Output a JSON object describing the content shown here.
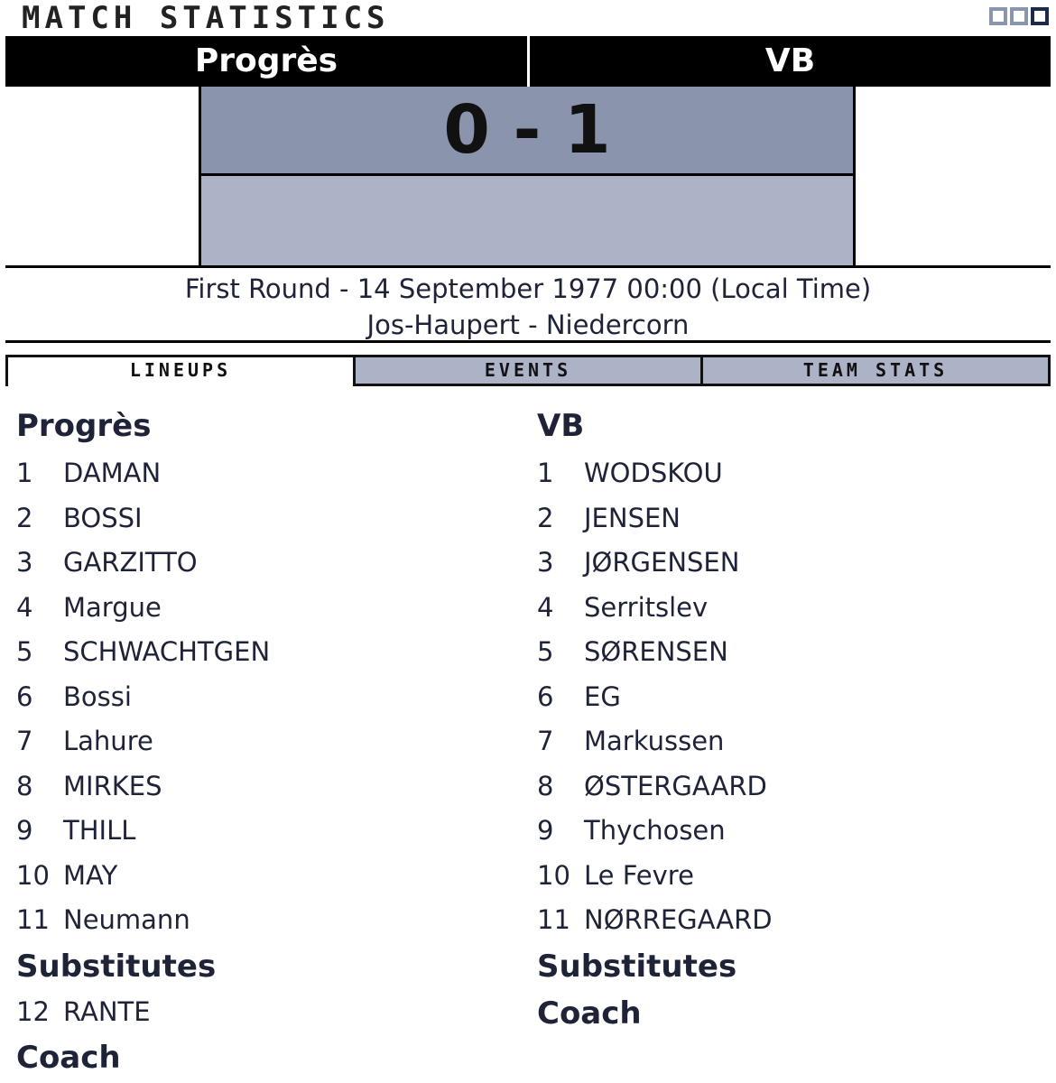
{
  "header": {
    "title": "Match Statistics"
  },
  "match": {
    "home_team": "Progrès",
    "away_team": "VB",
    "score": "0 - 1",
    "round_line": "First Round - 14 September 1977 00:00 (Local Time)",
    "venue_line": "Jos-Haupert - Niedercorn"
  },
  "tabs": [
    {
      "label": "Lineups",
      "active": true
    },
    {
      "label": "Events",
      "active": false
    },
    {
      "label": "Team Stats",
      "active": false
    }
  ],
  "lineups": {
    "home": {
      "team": "Progrès",
      "players": [
        {
          "num": "1",
          "name": "DAMAN"
        },
        {
          "num": "2",
          "name": "BOSSI"
        },
        {
          "num": "3",
          "name": "GARZITTO"
        },
        {
          "num": "4",
          "name": "Margue"
        },
        {
          "num": "5",
          "name": "SCHWACHTGEN"
        },
        {
          "num": "6",
          "name": "Bossi"
        },
        {
          "num": "7",
          "name": "Lahure"
        },
        {
          "num": "8",
          "name": "MIRKES"
        },
        {
          "num": "9",
          "name": "THILL"
        },
        {
          "num": "10",
          "name": "MAY"
        },
        {
          "num": "11",
          "name": "Neumann"
        }
      ],
      "substitutes_label": "Substitutes",
      "substitutes": [
        {
          "num": "12",
          "name": "RANTE"
        }
      ],
      "coach_label": "Coach"
    },
    "away": {
      "team": "VB",
      "players": [
        {
          "num": "1",
          "name": "WODSKOU"
        },
        {
          "num": "2",
          "name": "JENSEN"
        },
        {
          "num": "3",
          "name": "JØRGENSEN"
        },
        {
          "num": "4",
          "name": "Serritslev"
        },
        {
          "num": "5",
          "name": "SØRENSEN"
        },
        {
          "num": "6",
          "name": "EG"
        },
        {
          "num": "7",
          "name": "Markussen"
        },
        {
          "num": "8",
          "name": "ØSTERGAARD"
        },
        {
          "num": "9",
          "name": "Thychosen"
        },
        {
          "num": "10",
          "name": "Le Fevre"
        },
        {
          "num": "11",
          "name": "NØRREGAARD"
        }
      ],
      "substitutes_label": "Substitutes",
      "substitutes": [],
      "coach_label": "Coach"
    }
  }
}
